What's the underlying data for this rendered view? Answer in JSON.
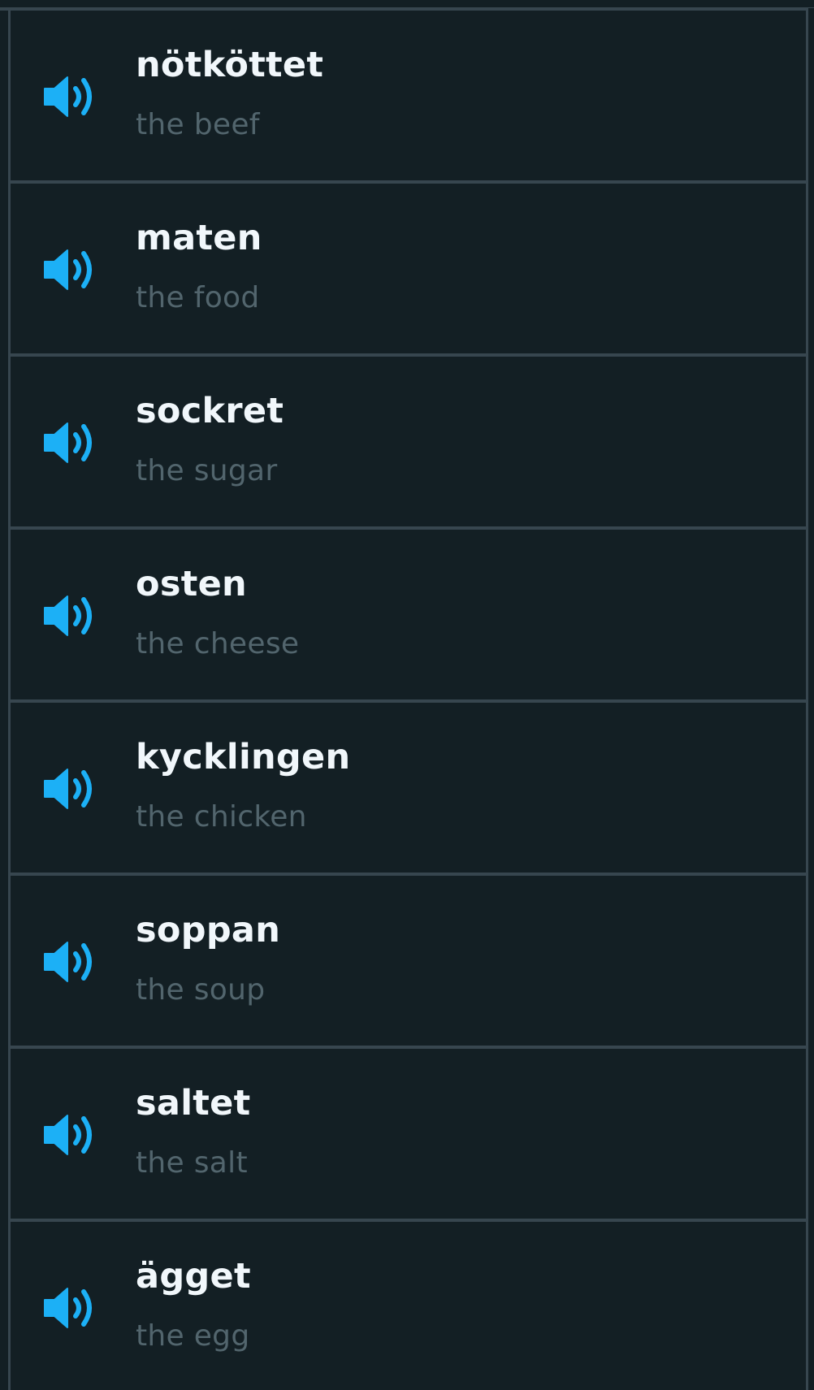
{
  "colors": {
    "background": "#131f24",
    "divider": "#37464f",
    "word": "#f1f7fb",
    "translation": "#52656d",
    "speaker_icon": "#1cb0f6"
  },
  "vocabulary": [
    {
      "word": "nötköttet",
      "translation": "the beef",
      "icon": "speaker-icon"
    },
    {
      "word": "maten",
      "translation": "the food",
      "icon": "speaker-icon"
    },
    {
      "word": "sockret",
      "translation": "the sugar",
      "icon": "speaker-icon"
    },
    {
      "word": "osten",
      "translation": "the cheese",
      "icon": "speaker-icon"
    },
    {
      "word": "kycklingen",
      "translation": "the chicken",
      "icon": "speaker-icon"
    },
    {
      "word": "soppan",
      "translation": "the soup",
      "icon": "speaker-icon"
    },
    {
      "word": "saltet",
      "translation": "the salt",
      "icon": "speaker-icon"
    },
    {
      "word": "ägget",
      "translation": "the egg",
      "icon": "speaker-icon"
    }
  ]
}
